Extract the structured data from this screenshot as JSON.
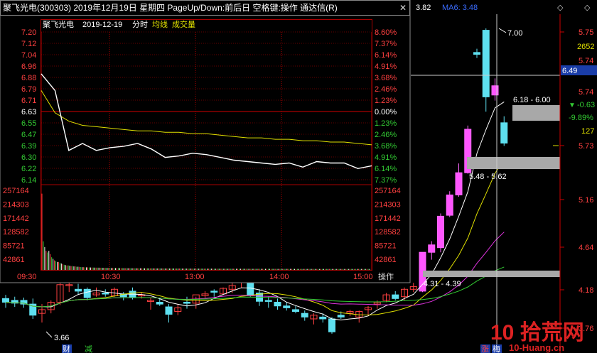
{
  "header": {
    "title": "聚飞光电(300303)  2019年12月19日  星期四  PageUp/Down:前后日  空格键:操作  通达信(R)",
    "ma_left_value": "3.82",
    "ma6_label": "MA6: 3.48"
  },
  "intraday": {
    "name": "聚飞光电",
    "date": "2019-12-19",
    "mode": "分时",
    "avg_label": "均线",
    "vol_label": "成交量",
    "op_label": "操作",
    "base_price": 6.63,
    "price_labels": [
      "7.20",
      "7.12",
      "7.04",
      "6.96",
      "6.88",
      "6.79",
      "6.71",
      "6.63",
      "6.55",
      "6.47",
      "6.39",
      "6.30",
      "6.22",
      "6.14"
    ],
    "pct_labels": [
      "8.60%",
      "7.37%",
      "6.14%",
      "4.91%",
      "3.68%",
      "2.46%",
      "1.23%",
      "0.00%",
      "1.23%",
      "2.46%",
      "3.68%",
      "4.91%",
      "6.14%",
      "7.37%"
    ],
    "vol_labels": [
      "257164",
      "214303",
      "171442",
      "128582",
      "85721",
      "42861"
    ],
    "time_labels": [
      "09:30",
      "10:30",
      "13:00",
      "14:00",
      "15:00"
    ],
    "colors": {
      "up": "#ff4040",
      "down": "#33cc33",
      "flat": "#ffffff",
      "price_line": "#ffffff",
      "avg_line": "#e0e000"
    }
  },
  "chart_data": [
    {
      "type": "line",
      "title": "聚飞光电 2019-12-19 分时",
      "xlabel": "",
      "ylabel": "",
      "ylim": [
        6.14,
        7.2
      ],
      "x": [
        "09:30",
        "09:40",
        "09:50",
        "10:00",
        "10:10",
        "10:20",
        "10:30",
        "10:40",
        "10:50",
        "11:00",
        "11:10",
        "11:20",
        "11:30",
        "13:10",
        "13:20",
        "13:30",
        "13:40",
        "13:50",
        "14:00",
        "14:10",
        "14:20",
        "14:30",
        "14:40",
        "14:50",
        "15:00"
      ],
      "series": [
        {
          "name": "price",
          "values": [
            6.9,
            6.78,
            6.35,
            6.4,
            6.35,
            6.37,
            6.38,
            6.4,
            6.36,
            6.3,
            6.31,
            6.33,
            6.32,
            6.3,
            6.28,
            6.27,
            6.26,
            6.25,
            6.26,
            6.23,
            6.27,
            6.26,
            6.26,
            6.22,
            6.24
          ]
        },
        {
          "name": "均线",
          "values": [
            6.78,
            6.62,
            6.56,
            6.53,
            6.52,
            6.51,
            6.5,
            6.49,
            6.49,
            6.48,
            6.48,
            6.47,
            6.47,
            6.46,
            6.45,
            6.44,
            6.44,
            6.43,
            6.43,
            6.42,
            6.42,
            6.41,
            6.41,
            6.4,
            6.39
          ]
        }
      ]
    },
    {
      "type": "bar",
      "title": "成交量",
      "ylim": [
        0,
        257164
      ],
      "series": [
        {
          "name": "成交量",
          "values": [
            240000,
            90000,
            72000,
            60000,
            55000,
            60000,
            50000,
            40000,
            35000,
            30000,
            28000,
            25000,
            25000,
            22000,
            20000,
            18000,
            16000,
            15000,
            14000,
            14000,
            13000,
            12000,
            12000,
            11000,
            11000,
            10000,
            10000,
            9500,
            9000,
            8500,
            8500,
            8200,
            8000,
            8000,
            7800,
            7600,
            7500,
            7300,
            7200,
            7100,
            7000,
            7000,
            6800,
            6800,
            6600,
            6500,
            6400,
            6300,
            6200,
            6100,
            6000,
            6000,
            5900,
            5800,
            5800,
            5700,
            5600,
            5600,
            5500,
            5500,
            5400,
            5400,
            5300,
            5300,
            5200,
            5200,
            5200,
            5100,
            5100,
            5000,
            5000,
            5000,
            4900,
            4900,
            4900,
            4800,
            4800,
            4800,
            4700,
            4700,
            4700,
            4600,
            4600,
            4600,
            4500,
            4500,
            4500,
            4500,
            4400,
            4400,
            4400,
            4400,
            4300,
            4300,
            4300,
            4300,
            4200,
            4200,
            4200,
            4200,
            4200,
            4100,
            4100,
            4100,
            4100,
            4000,
            4000,
            4000,
            4000,
            4000,
            4000,
            3900,
            3900,
            3900,
            3900,
            3900,
            3900,
            3800,
            3800,
            3800,
            3800,
            3800,
            3800,
            3800,
            3700,
            3700,
            3700,
            3700,
            3700,
            3700,
            3700,
            3600,
            3600,
            3600,
            3600,
            3600,
            3600,
            3600,
            3600,
            3500,
            3500,
            3500,
            3500,
            3500,
            3500,
            3500,
            3500,
            3500,
            3400,
            3400,
            3400,
            3400,
            3400,
            3400,
            3400,
            3400,
            3400,
            3400,
            3300,
            3300,
            3300,
            3300,
            3300,
            3300,
            3300,
            3300,
            3300,
            3300,
            3300,
            3200,
            3200,
            3200,
            3200,
            3200,
            3200,
            3200,
            3200,
            3200,
            3200,
            3200,
            3200,
            3200,
            3100,
            3100,
            3100,
            3100,
            3100,
            3100,
            3100,
            3100,
            3100,
            3100,
            3100,
            3100,
            3100,
            3100,
            3100,
            3000,
            3000,
            3000,
            3000,
            3000,
            3000,
            3000,
            3000,
            3000,
            3000,
            3000,
            3000,
            3000,
            3000,
            3000,
            3000,
            3000,
            3000,
            3000,
            3000,
            3000,
            3000,
            3000,
            3000,
            3000,
            3000,
            3000,
            3000,
            3000,
            3000,
            3000,
            3000,
            3000,
            3000,
            3000,
            3000,
            3000,
            3000,
            3000,
            3000
          ]
        }
      ]
    },
    {
      "type": "candlestick",
      "title": "",
      "ylim": [
        3.76,
        7.0
      ],
      "right_axis": [
        "5.75",
        "5.74",
        "5.74",
        "5.73",
        "5.16",
        "4.64",
        "4.18",
        "3.76"
      ],
      "right_panel": {
        "vol1": "2652",
        "price_box": "6.49",
        "chg": "-0.63",
        "pct": "-9.89%",
        "vol2": "127"
      },
      "annotations": {
        "high": "7.00",
        "zone_hi": "6.18 - 6.00",
        "zone_mid": "5.48 - 5.62",
        "zone_lo": "4.31 - 4.39",
        "low": "3.66"
      },
      "bottom_labels": [
        "财",
        "减",
        "涨",
        "梅"
      ],
      "candles": [
        {
          "o": 4.08,
          "h": 4.12,
          "l": 3.98,
          "c": 4.04
        },
        {
          "o": 4.06,
          "h": 4.1,
          "l": 3.99,
          "c": 4.03
        },
        {
          "o": 4.06,
          "h": 4.09,
          "l": 3.98,
          "c": 4.02
        },
        {
          "o": 4.02,
          "h": 4.08,
          "l": 3.86,
          "c": 3.9
        },
        {
          "o": 3.92,
          "h": 4.02,
          "l": 3.82,
          "c": 3.96
        },
        {
          "o": 3.96,
          "h": 4.06,
          "l": 3.92,
          "c": 4.04
        },
        {
          "o": 4.04,
          "h": 4.28,
          "l": 4.01,
          "c": 4.23
        },
        {
          "o": 4.22,
          "h": 4.32,
          "l": 4.15,
          "c": 4.23
        },
        {
          "o": 4.18,
          "h": 4.24,
          "l": 4.12,
          "c": 4.16
        },
        {
          "o": 4.18,
          "h": 4.2,
          "l": 4.06,
          "c": 4.09
        },
        {
          "o": 4.12,
          "h": 4.2,
          "l": 4.1,
          "c": 4.14
        },
        {
          "o": 4.14,
          "h": 4.18,
          "l": 4.1,
          "c": 4.13
        },
        {
          "o": 4.11,
          "h": 4.2,
          "l": 4.1,
          "c": 4.18
        },
        {
          "o": 4.13,
          "h": 4.15,
          "l": 4.06,
          "c": 4.1
        },
        {
          "o": 4.16,
          "h": 4.2,
          "l": 4.07,
          "c": 4.09
        },
        {
          "o": 4.12,
          "h": 4.14,
          "l": 4.08,
          "c": 4.12
        },
        {
          "o": 4.06,
          "h": 4.09,
          "l": 3.96,
          "c": 4.06
        },
        {
          "o": 4.04,
          "h": 4.08,
          "l": 4.0,
          "c": 4.02
        },
        {
          "o": 3.99,
          "h": 4.02,
          "l": 3.82,
          "c": 3.91
        },
        {
          "o": 3.94,
          "h": 4.02,
          "l": 3.9,
          "c": 3.98
        },
        {
          "o": 4.04,
          "h": 4.1,
          "l": 3.97,
          "c": 4.03
        },
        {
          "o": 4.03,
          "h": 4.1,
          "l": 3.97,
          "c": 4.12
        },
        {
          "o": 4.11,
          "h": 4.16,
          "l": 4.08,
          "c": 4.13
        },
        {
          "o": 4.16,
          "h": 4.18,
          "l": 4.1,
          "c": 4.15
        },
        {
          "o": 4.13,
          "h": 4.2,
          "l": 4.12,
          "c": 4.19
        },
        {
          "o": 4.18,
          "h": 4.25,
          "l": 4.14,
          "c": 4.22
        },
        {
          "o": 4.26,
          "h": 4.3,
          "l": 4.2,
          "c": 4.29
        },
        {
          "o": 4.26,
          "h": 4.28,
          "l": 4.1,
          "c": 4.12
        },
        {
          "o": 4.14,
          "h": 4.18,
          "l": 4.0,
          "c": 4.05
        },
        {
          "o": 4.06,
          "h": 4.1,
          "l": 3.98,
          "c": 4.05
        },
        {
          "o": 4.04,
          "h": 4.08,
          "l": 3.96,
          "c": 4.0
        },
        {
          "o": 4.0,
          "h": 4.04,
          "l": 3.95,
          "c": 3.98
        },
        {
          "o": 3.96,
          "h": 4.0,
          "l": 3.92,
          "c": 3.94
        },
        {
          "o": 3.92,
          "h": 3.95,
          "l": 3.84,
          "c": 3.88
        },
        {
          "o": 3.86,
          "h": 3.92,
          "l": 3.8,
          "c": 3.9
        },
        {
          "o": 3.88,
          "h": 3.92,
          "l": 3.82,
          "c": 3.86
        },
        {
          "o": 3.86,
          "h": 3.88,
          "l": 3.7,
          "c": 3.72
        },
        {
          "o": 3.9,
          "h": 3.94,
          "l": 3.86,
          "c": 3.88
        },
        {
          "o": 3.92,
          "h": 3.96,
          "l": 3.89,
          "c": 3.94
        },
        {
          "o": 3.88,
          "h": 3.95,
          "l": 3.82,
          "c": 3.94
        },
        {
          "o": 3.96,
          "h": 4.0,
          "l": 3.9,
          "c": 3.98
        },
        {
          "o": 4.02,
          "h": 4.06,
          "l": 3.97,
          "c": 4.04
        },
        {
          "o": 4.06,
          "h": 4.14,
          "l": 4.04,
          "c": 4.12
        },
        {
          "o": 4.12,
          "h": 4.16,
          "l": 4.06,
          "c": 4.08
        },
        {
          "o": 4.1,
          "h": 4.2,
          "l": 4.06,
          "c": 4.18
        },
        {
          "o": 4.18,
          "h": 4.25,
          "l": 4.15,
          "c": 4.21
        },
        {
          "o": 4.16,
          "h": 4.58,
          "l": 4.15,
          "c": 4.58
        },
        {
          "o": 4.58,
          "h": 4.7,
          "l": 4.5,
          "c": 4.66
        },
        {
          "o": 4.63,
          "h": 5.0,
          "l": 4.58,
          "c": 4.97
        },
        {
          "o": 4.98,
          "h": 5.24,
          "l": 4.96,
          "c": 5.2
        },
        {
          "o": 5.2,
          "h": 5.54,
          "l": 5.18,
          "c": 5.44
        },
        {
          "o": 5.44,
          "h": 5.95,
          "l": 5.43,
          "c": 5.91
        },
        {
          "o": 6.74,
          "h": 6.78,
          "l": 6.68,
          "c": 6.72
        },
        {
          "o": 6.98,
          "h": 7.0,
          "l": 6.1,
          "c": 6.26
        },
        {
          "o": 6.28,
          "h": 6.46,
          "l": 6.22,
          "c": 6.38
        },
        {
          "o": 5.98,
          "h": 6.05,
          "l": 5.73,
          "c": 5.76
        }
      ]
    }
  ],
  "watermark": {
    "text": "10 拾荒网",
    "sub": "10-Huang.cn"
  }
}
